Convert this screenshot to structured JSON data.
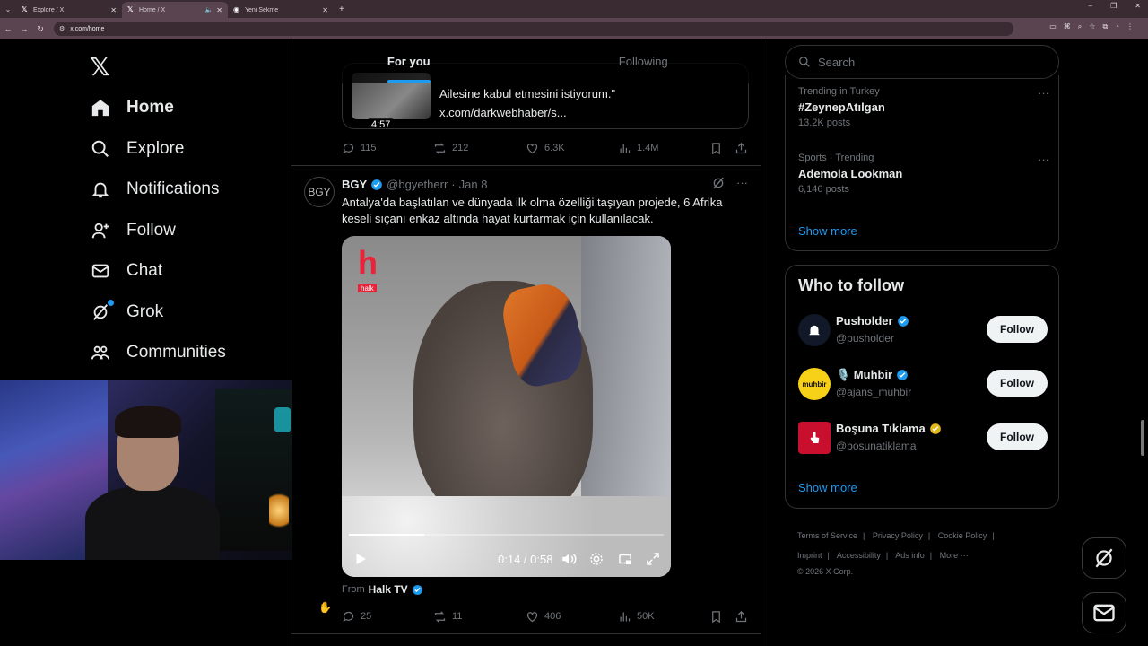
{
  "browser": {
    "tabs": [
      {
        "title": "Explore / X",
        "icon": "x-logo-icon"
      },
      {
        "title": "Home / X",
        "icon": "x-logo-icon"
      },
      {
        "title": "Yeni Sekme",
        "icon": "globe-icon"
      }
    ],
    "url": "x.com/home"
  },
  "leftnav": {
    "logo": "𝕏",
    "items": [
      {
        "label": "Home",
        "icon": "home-icon"
      },
      {
        "label": "Explore",
        "icon": "search-icon"
      },
      {
        "label": "Notifications",
        "icon": "bell-icon"
      },
      {
        "label": "Follow",
        "icon": "add-person-icon"
      },
      {
        "label": "Chat",
        "icon": "mail-icon"
      },
      {
        "label": "Grok",
        "icon": "grok-icon"
      },
      {
        "label": "Communities",
        "icon": "people-icon"
      }
    ]
  },
  "feed": {
    "tabs": [
      "For you",
      "Following"
    ],
    "quote_card": {
      "duration": "4:57",
      "line1": "Ailesine kabul etmesini istiyorum.\"",
      "line2": "x.com/darkwebhaber/s..."
    },
    "prev_actions": {
      "replies": "115",
      "reposts": "212",
      "likes": "6.3K",
      "views": "1.4M"
    },
    "post": {
      "avatar": "BGY",
      "name": "BGY",
      "handle": "@bgyetherr",
      "dot": "·",
      "date": "Jan 8",
      "text": "Antalya'da başlatılan ve dünyada ilk olma özelliği taşıyan projede, 6 Afrika keseli sıçanı enkaz altında hayat kurtarmak için kullanılacak.",
      "video": {
        "logo": "h",
        "logo_sub": "halk",
        "time": "0:14 / 0:58",
        "progress": 0.24
      },
      "from_label": "From",
      "from_source": "Halk TV",
      "actions": {
        "replies": "25",
        "reposts": "11",
        "likes": "406",
        "views": "50K"
      }
    }
  },
  "right": {
    "search_placeholder": "Search",
    "trends": [
      {
        "category": "Trending in Turkey",
        "name": "#ZeynepAtılgan",
        "posts": "13.2K posts"
      },
      {
        "category": "Sports · Trending",
        "name": "Ademola Lookman",
        "posts": "6,146 posts"
      }
    ],
    "show_more": "Show more",
    "who_to_follow": {
      "title": "Who to follow",
      "accounts": [
        {
          "name": "Pusholder",
          "handle": "@pusholder",
          "badge_color": "#1d9bf0",
          "avatar_bg": "#111827"
        },
        {
          "name": "🎙️ Muhbir",
          "handle": "@ajans_muhbir",
          "badge_color": "#1d9bf0",
          "avatar_bg": "#f7d117",
          "avatar_text": "muhbir"
        },
        {
          "name": "Boşuna Tıklama",
          "handle": "@bosunatiklama",
          "badge_color": "#e2b719",
          "avatar_bg": "#c8102e"
        }
      ],
      "follow_label": "Follow",
      "show_more": "Show more"
    },
    "footer": {
      "links": [
        "Terms of Service",
        "Privacy Policy",
        "Cookie Policy",
        "Imprint",
        "Accessibility",
        "Ads info",
        "More ···"
      ],
      "copyright": "© 2026 X Corp."
    }
  },
  "colors": {
    "accent": "#1d9bf0",
    "background": "#000000",
    "border": "#2f3336",
    "muted": "#71767b",
    "text": "#e7e9ea"
  }
}
